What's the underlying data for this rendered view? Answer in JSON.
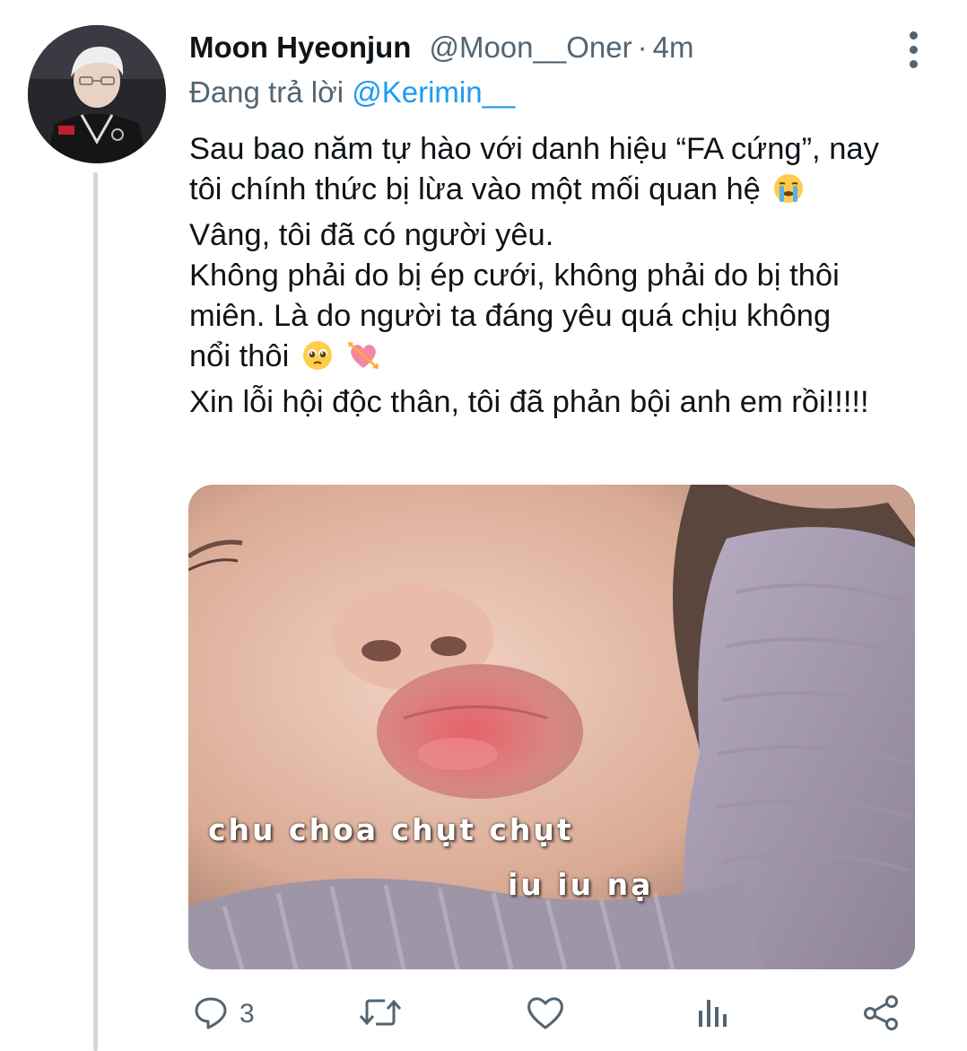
{
  "author": {
    "name": "Moon Hyeonjun",
    "handle": "@Moon__Oner",
    "separator": "·",
    "time": "4m"
  },
  "reply": {
    "prefix": "Đang trả lời",
    "mention": "@Kerimin__"
  },
  "tweet_lines": [
    "Sau bao năm tự hào với danh hiệu “FA cứng”, nay",
    "tôi chính thức bị lừa vào một mối quan hệ",
    "Vâng, tôi đã có người yêu.",
    "Không phải do bị ép cưới, không phải do bị thôi",
    "miên. Là do người ta đáng yêu quá chịu không",
    "nổi thôi",
    "Xin lỗi hội độc thân, tôi đã phản bội anh em rồi!!!!!"
  ],
  "media": {
    "caption_line1": "chu choa chụt chụt",
    "caption_line2": "iu iu nạ"
  },
  "actions": {
    "reply_count": "3",
    "icons": [
      "reply-icon",
      "retweet-icon",
      "like-icon",
      "analytics-icon",
      "share-icon"
    ]
  },
  "colors": {
    "text": "#0f1419",
    "secondary": "#536471",
    "link": "#1d9bf0",
    "thread_line": "#cfd9de"
  }
}
